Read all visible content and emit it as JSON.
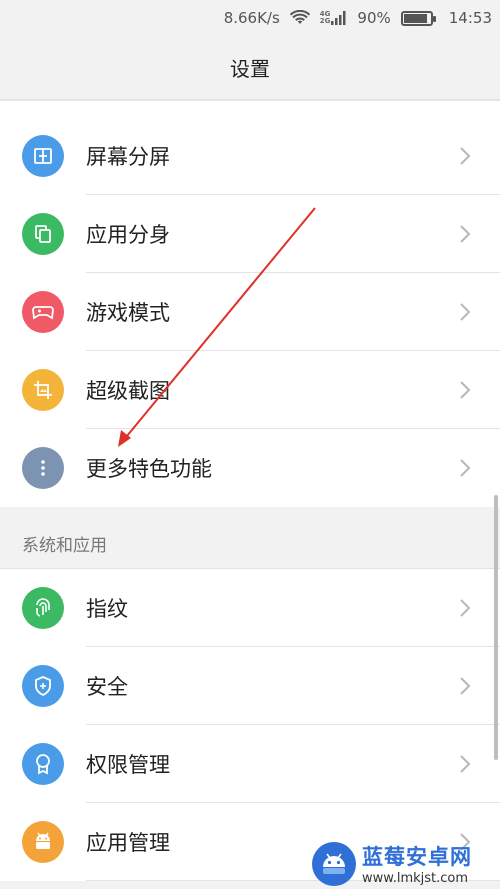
{
  "statusbar": {
    "speed": "8.66K/s",
    "network_top": "4G",
    "network_bottom": "2G",
    "battery_percent": "90%",
    "battery_level": 0.9,
    "time": "14:53"
  },
  "header": {
    "title": "设置"
  },
  "group1": {
    "items": [
      {
        "label": "屏幕分屏",
        "icon": "split-screen-icon",
        "color": "#4a9be8"
      },
      {
        "label": "应用分身",
        "icon": "app-clone-icon",
        "color": "#3cba63"
      },
      {
        "label": "游戏模式",
        "icon": "gamepad-icon",
        "color": "#ef5a66"
      },
      {
        "label": "超级截图",
        "icon": "screenshot-icon",
        "color": "#f4b43a"
      },
      {
        "label": "更多特色功能",
        "icon": "more-dots-icon",
        "color": "#7d93b2"
      }
    ]
  },
  "section2": {
    "title": "系统和应用",
    "items": [
      {
        "label": "指纹",
        "icon": "fingerprint-icon",
        "color": "#3cba63"
      },
      {
        "label": "安全",
        "icon": "shield-icon",
        "color": "#4a9be8"
      },
      {
        "label": "权限管理",
        "icon": "permission-icon",
        "color": "#4a9be8"
      },
      {
        "label": "应用管理",
        "icon": "android-icon",
        "color": "#f4a23a"
      }
    ]
  },
  "watermark": {
    "name": "蓝莓安卓网",
    "url": "www.lmkjst.com"
  },
  "annotation": {
    "arrow_color": "#e0302a"
  }
}
